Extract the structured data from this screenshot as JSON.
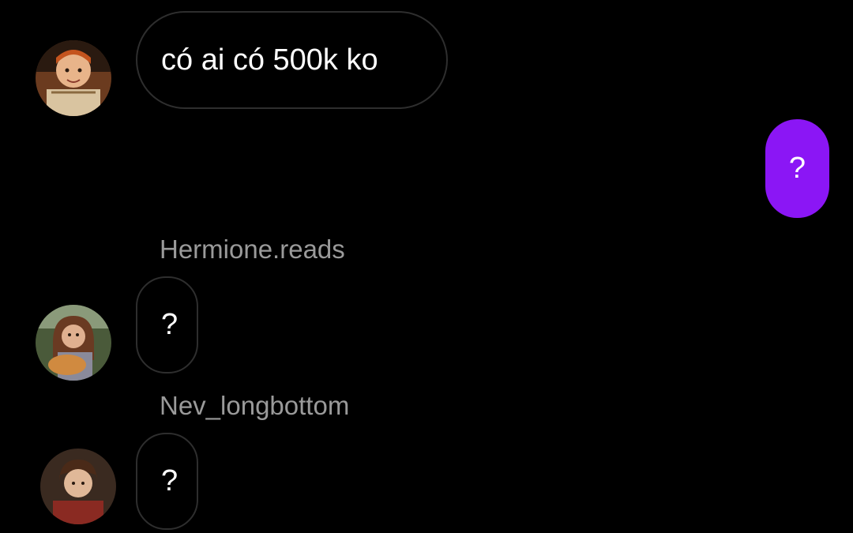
{
  "colors": {
    "background": "#000000",
    "outgoing_bubble": "#8b16f5",
    "incoming_border": "#2e2e2e",
    "sender_name": "#9a9a9a"
  },
  "messages": [
    {
      "direction": "incoming",
      "sender": "",
      "text": "có ai có 500k ko",
      "avatar": "ron-avatar"
    },
    {
      "direction": "outgoing",
      "sender": "",
      "text": "?"
    },
    {
      "direction": "incoming",
      "sender": "Hermione.reads",
      "text": "?",
      "avatar": "hermione-avatar"
    },
    {
      "direction": "incoming",
      "sender": "Nev_longbottom",
      "text": "?",
      "avatar": "neville-avatar"
    }
  ]
}
